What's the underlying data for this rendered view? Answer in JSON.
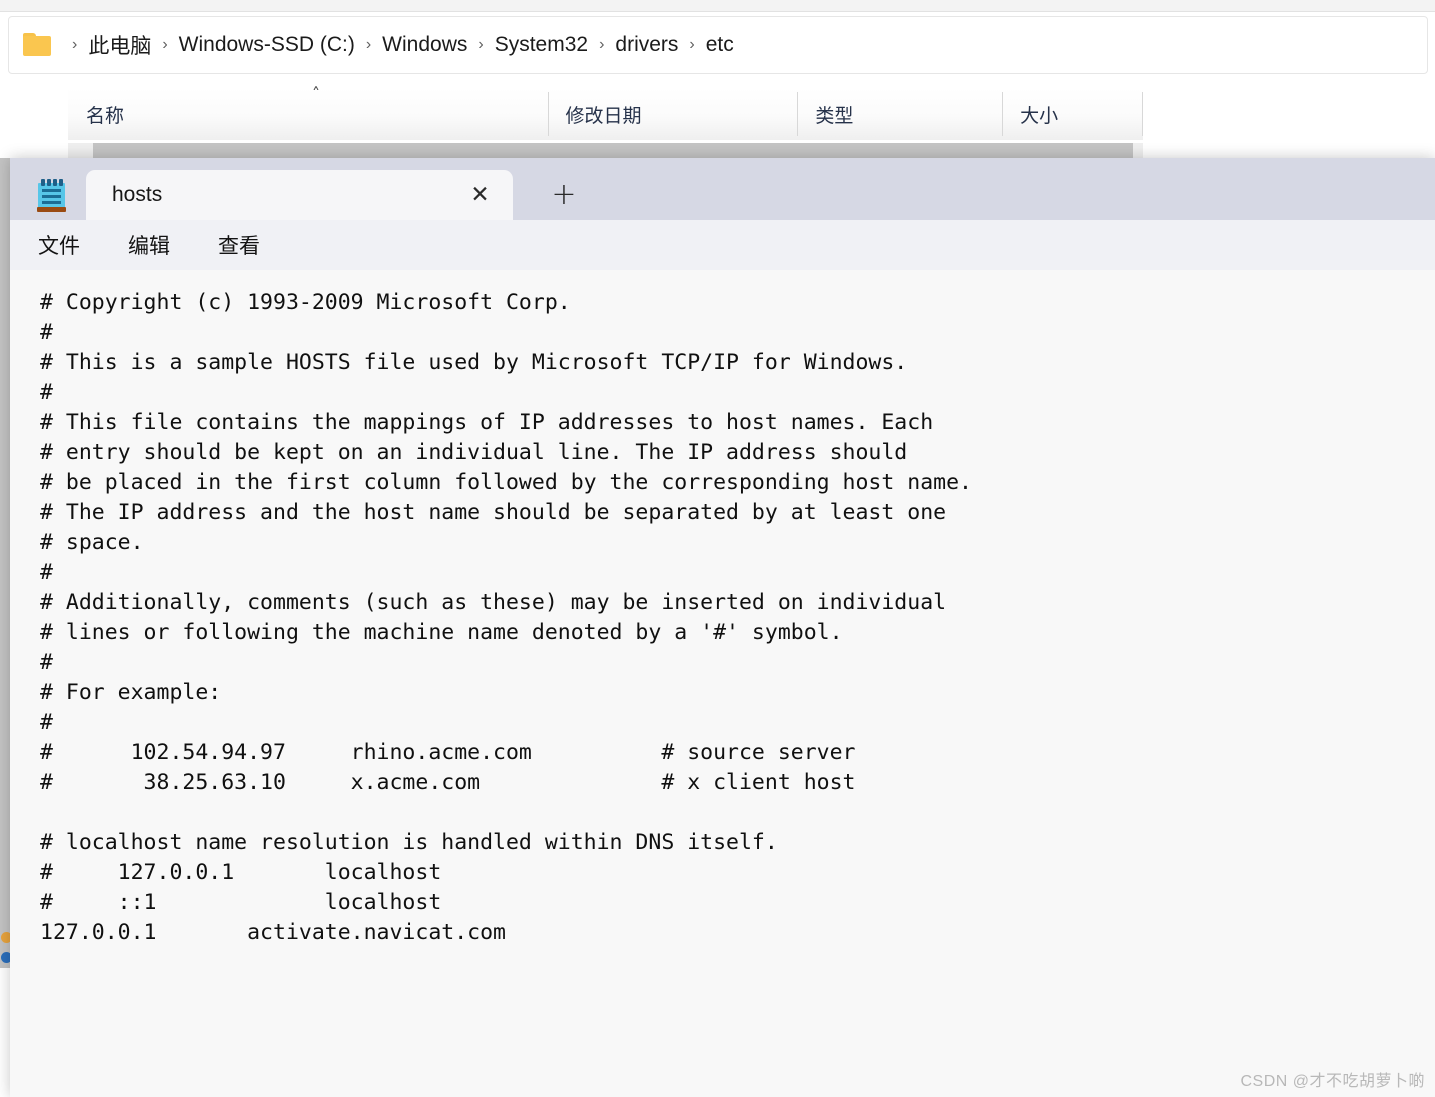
{
  "explorer": {
    "folder_icon": "folder-icon",
    "breadcrumb": {
      "separator": "›",
      "items": [
        "此电脑",
        "Windows-SSD (C:)",
        "Windows",
        "System32",
        "drivers",
        "etc"
      ]
    },
    "columns": [
      {
        "label": "名称",
        "sorted": "asc"
      },
      {
        "label": "修改日期",
        "sorted": ""
      },
      {
        "label": "类型",
        "sorted": ""
      },
      {
        "label": "大小",
        "sorted": ""
      }
    ],
    "sort_arrow": "˄"
  },
  "notepad": {
    "app_icon": "notepad-icon",
    "tab": {
      "title": "hosts",
      "close_label": "✕"
    },
    "new_tab_label": "+",
    "menu": [
      "文件",
      "编辑",
      "查看"
    ],
    "document": {
      "filename": "hosts",
      "lines": [
        "# Copyright (c) 1993-2009 Microsoft Corp.",
        "#",
        "# This is a sample HOSTS file used by Microsoft TCP/IP for Windows.",
        "#",
        "# This file contains the mappings of IP addresses to host names. Each",
        "# entry should be kept on an individual line. The IP address should",
        "# be placed in the first column followed by the corresponding host name.",
        "# The IP address and the host name should be separated by at least one",
        "# space.",
        "#",
        "# Additionally, comments (such as these) may be inserted on individual",
        "# lines or following the machine name denoted by a '#' symbol.",
        "#",
        "# For example:",
        "#",
        "#      102.54.94.97     rhino.acme.com          # source server",
        "#       38.25.63.10     x.acme.com              # x client host",
        "",
        "# localhost name resolution is handled within DNS itself.",
        "#     127.0.0.1       localhost",
        "#     ::1             localhost",
        "127.0.0.1       activate.navicat.com"
      ],
      "text": "# Copyright (c) 1993-2009 Microsoft Corp.\n#\n# This is a sample HOSTS file used by Microsoft TCP/IP for Windows.\n#\n# This file contains the mappings of IP addresses to host names. Each\n# entry should be kept on an individual line. The IP address should\n# be placed in the first column followed by the corresponding host name.\n# The IP address and the host name should be separated by at least one\n# space.\n#\n# Additionally, comments (such as these) may be inserted on individual\n# lines or following the machine name denoted by a '#' symbol.\n#\n# For example:\n#\n#      102.54.94.97     rhino.acme.com          # source server\n#       38.25.63.10     x.acme.com              # x client host\n\n# localhost name resolution is handled within DNS itself.\n#     127.0.0.1       localhost\n#     ::1             localhost\n127.0.0.1       activate.navicat.com"
    }
  },
  "watermark": "CSDN @才不吃胡萝卜啲",
  "colors": {
    "titlebar": "#d6d8e4",
    "menubar": "#f0f1f5",
    "editor_bg": "#f8f8f8",
    "tab_active": "#f6f6f8",
    "header_text": "#26324a",
    "folder": "#fac64f"
  }
}
